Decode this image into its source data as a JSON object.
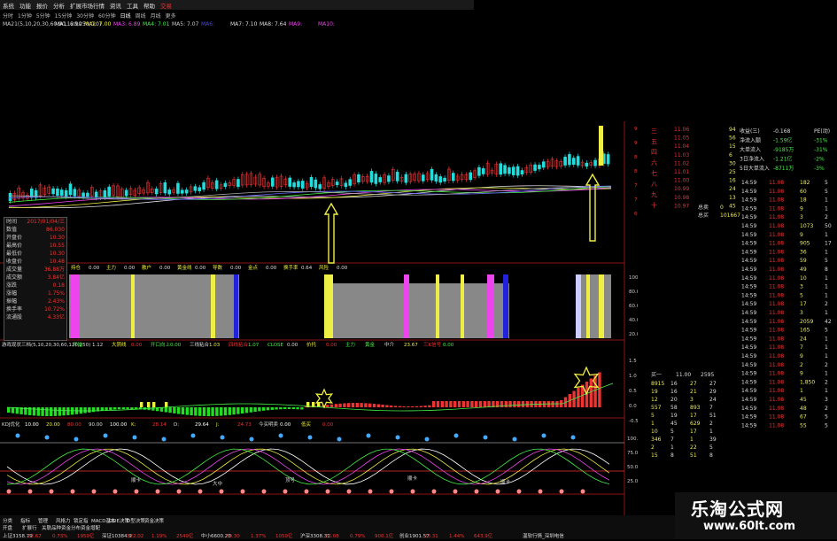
{
  "menu": {
    "items": [
      "系统",
      "功能",
      "报价",
      "分析",
      "扩展市场行情",
      "资讯",
      "工具",
      "帮助"
    ],
    "extra": "交易",
    "right": "交易系统"
  },
  "periods": [
    "分时",
    "1分钟",
    "5分钟",
    "15分钟",
    "30分钟",
    "60分钟",
    "日线",
    "周线",
    "月线",
    "更多"
  ],
  "main": {
    "ma_header": "MA21(5,10,20,30,60,90,120,250,0,0)",
    "ma_values": [
      "MA1: 6.90",
      "MA2: 7.00",
      "MA3: 6.89",
      "MA4: 7.01",
      "MA5: 7.07",
      "MA6: ",
      "MA7: 7.10",
      "MA8: 7.64",
      "MA9: ",
      "MA10: "
    ],
    "price_ticks": [
      "9.50",
      "9.00",
      "8.50",
      "8.00",
      "7.50",
      "7.00",
      "6.50"
    ]
  },
  "info_panel": {
    "rows": [
      {
        "k": "时间",
        "v": "2017/01/04/三"
      },
      {
        "k": "数值",
        "v": "86.030"
      },
      {
        "k": "开盘价",
        "v": "10.30"
      },
      {
        "k": "最高价",
        "v": "10.55"
      },
      {
        "k": "最低价",
        "v": "10.30"
      },
      {
        "k": "收盘价",
        "v": "10.48"
      },
      {
        "k": "成交量",
        "v": "36.88万"
      },
      {
        "k": "成交额",
        "v": "3.84亿"
      },
      {
        "k": "涨跌",
        "v": "0.18"
      },
      {
        "k": "涨幅",
        "v": "1.75%"
      },
      {
        "k": "振幅",
        "v": "2.43%"
      },
      {
        "k": "换手率",
        "v": "10.72%"
      },
      {
        "k": "流通股",
        "v": "4.33亿"
      }
    ]
  },
  "panel2": {
    "labels": [
      "持仓",
      "0.00",
      "主力",
      "0.00",
      "散户",
      "0.00",
      "黄金线",
      "0.00",
      "导数",
      "0.00",
      "金点",
      "0.00",
      "换手率",
      "0.64",
      "风险",
      "0.00"
    ],
    "ticks": [
      "100.00",
      "80.00",
      "60.00",
      "40.00",
      "20.00"
    ]
  },
  "panel3": {
    "header": "游戏现状三档(5,10,20,30,60,120,250)",
    "items": [
      "开始",
      "1.12",
      "大阴线",
      "0.00",
      "开口向上",
      "0.00",
      "三线粘合",
      "1.03",
      "四线粘合",
      "1.07",
      "CLOSE",
      "0.00",
      "价托",
      "0.00",
      "主力",
      "黄金",
      "中介",
      "23.67",
      "三K信号",
      "0.00"
    ],
    "ticks": [
      "1.5",
      "1.0",
      "0.5",
      "0.0",
      "-0.5"
    ]
  },
  "panel4": {
    "header": "KDJ优化",
    "values": [
      "10.00",
      "20.00",
      "80.00",
      "90.00",
      "100.00",
      "K:",
      "28.14",
      "D:",
      "29.64",
      "J:",
      "24.73",
      "今买明卖",
      "0.00",
      "低买",
      "0.00"
    ],
    "ticks": [
      "100.00",
      "75.00",
      "50.00",
      "25.00"
    ],
    "markers": [
      "顺卡",
      "大中",
      "顶号",
      "顺卡",
      "顺卡"
    ]
  },
  "right_panel": {
    "side_labels": [
      "三",
      "五",
      "四",
      "六",
      "七",
      "八",
      "九",
      "十"
    ],
    "order_rows": [
      {
        "p": "11.06",
        "v": "94"
      },
      {
        "p": "11.05",
        "v": "56"
      },
      {
        "p": "11.04",
        "v": "15"
      },
      {
        "p": "11.03",
        "v": "6"
      },
      {
        "p": "11.02",
        "v": "30"
      },
      {
        "p": "11.01",
        "v": "25"
      },
      {
        "p": "11.00",
        "v": "16"
      },
      {
        "p": "10.99",
        "v": "24"
      },
      {
        "p": "10.98",
        "v": "13"
      },
      {
        "p": "10.97",
        "v": "45"
      }
    ],
    "summary": [
      {
        "k": "总卖",
        "v": "0"
      },
      {
        "k": "总买",
        "v": "101667"
      }
    ],
    "flow": [
      {
        "k": "收益(三)",
        "v": "-0.168",
        "x": "PE(动)"
      },
      {
        "k": "净流入额",
        "v": "-1.59亿",
        "x": "-31%"
      },
      {
        "k": "大单流入",
        "v": "-9185万",
        "x": "-31%"
      },
      {
        "k": "3日净流入",
        "v": "-1.21亿",
        "x": "-2%"
      },
      {
        "k": "5日大单流入",
        "v": "-8711万",
        "x": "-3%"
      }
    ],
    "ticks": [
      {
        "t": "14:59",
        "p": "11.08",
        "v": "182",
        "n": "5"
      },
      {
        "t": "14:59",
        "p": "11.08",
        "v": "60",
        "n": "5"
      },
      {
        "t": "14:59",
        "p": "11.08",
        "v": "18",
        "n": "1"
      },
      {
        "t": "14:59",
        "p": "11.08",
        "v": "9",
        "n": "1"
      },
      {
        "t": "14:59",
        "p": "11.08",
        "v": "3",
        "n": "2"
      },
      {
        "t": "14:59",
        "p": "11.08",
        "v": "1073",
        "n": "50"
      },
      {
        "t": "14:59",
        "p": "11.08",
        "v": "9",
        "n": "1"
      },
      {
        "t": "14:59",
        "p": "11.08",
        "v": "905",
        "n": "17"
      },
      {
        "t": "14:59",
        "p": "11.08",
        "v": "36",
        "n": "1"
      },
      {
        "t": "14:59",
        "p": "11.08",
        "v": "59",
        "n": "5"
      },
      {
        "t": "14:59",
        "p": "11.08",
        "v": "49",
        "n": "8"
      },
      {
        "t": "14:59",
        "p": "11.08",
        "v": "10",
        "n": "1"
      },
      {
        "t": "14:59",
        "p": "11.08",
        "v": "3",
        "n": "1"
      },
      {
        "t": "14:59",
        "p": "11.08",
        "v": "5",
        "n": "1"
      },
      {
        "t": "14:59",
        "p": "11.08",
        "v": "17",
        "n": "2"
      },
      {
        "t": "14:59",
        "p": "11.08",
        "v": "3",
        "n": "1"
      },
      {
        "t": "14:59",
        "p": "11.08",
        "v": "2059",
        "n": "42"
      },
      {
        "t": "14:59",
        "p": "11.08",
        "v": "165",
        "n": "5"
      },
      {
        "t": "14:59",
        "p": "11.08",
        "v": "24",
        "n": "1"
      },
      {
        "t": "14:59",
        "p": "11.08",
        "v": "7",
        "n": "1"
      },
      {
        "t": "14:59",
        "p": "11.08",
        "v": "9",
        "n": "1"
      },
      {
        "t": "14:59",
        "p": "11.08",
        "v": "2",
        "n": "2"
      },
      {
        "t": "14:59",
        "p": "11.08",
        "v": "9",
        "n": "1"
      },
      {
        "t": "14:59",
        "p": "11.08",
        "v": "1,850",
        "n": "2"
      },
      {
        "t": "14:59",
        "p": "11.08",
        "v": "1",
        "n": "1"
      },
      {
        "t": "14:59",
        "p": "11.08",
        "v": "45",
        "n": "3"
      },
      {
        "t": "14:59",
        "p": "11.08",
        "v": "48",
        "n": "2"
      },
      {
        "t": "14:59",
        "p": "11.08",
        "v": "67",
        "n": "5"
      },
      {
        "t": "14:59",
        "p": "11.08",
        "v": "55",
        "n": "5"
      }
    ],
    "mini_head": [
      "买一",
      "11.00",
      "2595"
    ],
    "mini_rows": [
      {
        "a": "8915",
        "b": "16",
        "c": "27",
        "d": "27"
      },
      {
        "a": "19",
        "b": "16",
        "c": "21",
        "d": "29"
      },
      {
        "a": "12",
        "b": "20",
        "c": "3",
        "d": "24"
      },
      {
        "a": "557",
        "b": "58",
        "c": "893",
        "d": "7"
      },
      {
        "a": "5",
        "b": "19",
        "c": "17",
        "d": "51"
      },
      {
        "a": "1",
        "b": "45",
        "c": "629",
        "d": "2"
      },
      {
        "a": "10",
        "b": "5",
        "c": "17",
        "d": "1"
      },
      {
        "a": "346",
        "b": "7",
        "c": "1",
        "d": "39"
      },
      {
        "a": "2",
        "b": "1",
        "c": "22",
        "d": "5"
      },
      {
        "a": "15",
        "b": "8",
        "c": "51",
        "d": "8"
      }
    ]
  },
  "bottom": {
    "tabs": [
      "分类",
      "指标",
      "管理",
      "风格力",
      "锁定指",
      "MACD基本",
      "DDE决策",
      "D型决策",
      "资金决策"
    ],
    "tabs2": [
      "开盘",
      "扩展行",
      "关联品种",
      "资金分布",
      "资金增配"
    ],
    "index_line": [
      "上证3158.79",
      "22.67",
      "0.73%",
      "1959亿",
      "深证10384.9",
      "122.02",
      "1.19%",
      "2549亿",
      "中小6600.20",
      "89.30",
      "1.37%",
      "1059亿",
      "沪深3308.31",
      "26.08",
      "0.79%",
      "900.1亿",
      "创业1901.57",
      "28.31",
      "1.44%",
      "643.9亿"
    ],
    "status": "温软行情_深圳电信"
  },
  "watermark": {
    "line1": "乐淘公式网",
    "line2": "www.60lt.com"
  }
}
